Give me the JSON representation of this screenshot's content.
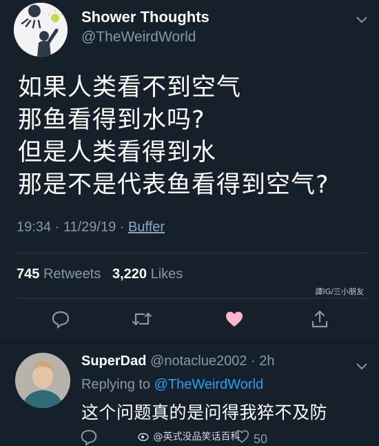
{
  "tweet": {
    "author": {
      "name": "Shower Thoughts",
      "handle": "@TheWeirdWorld"
    },
    "text_lines": [
      "如果人类看不到空气",
      "那鱼看得到水吗?",
      "但是人类看得到水",
      "那是不是代表鱼看得到空气?"
    ],
    "time": "19:34",
    "date": "11/29/19",
    "separator": "·",
    "source": "Buffer",
    "retweets": {
      "count": "745",
      "label": "Retweets"
    },
    "likes": {
      "count": "3,220",
      "label": "Likes"
    },
    "translator_credit": "譯IG/三小朋友",
    "actions": [
      "reply-icon",
      "retweet-icon",
      "like-icon",
      "share-icon"
    ],
    "like_color": "#ffb6c9"
  },
  "reply": {
    "author": {
      "name": "SuperDad",
      "handle": "@notaclue2002",
      "time": "2h"
    },
    "replying_to_label": "Replying to",
    "replying_to_handle": "@TheWeirdWorld",
    "text": "这个问题真的是问得我猝不及防",
    "like_count": "50"
  },
  "watermark": {
    "text": "@英式没品笑话百科"
  },
  "colors": {
    "background": "#15202b",
    "secondary_text": "#8899a6",
    "link": "#1da1f2"
  }
}
